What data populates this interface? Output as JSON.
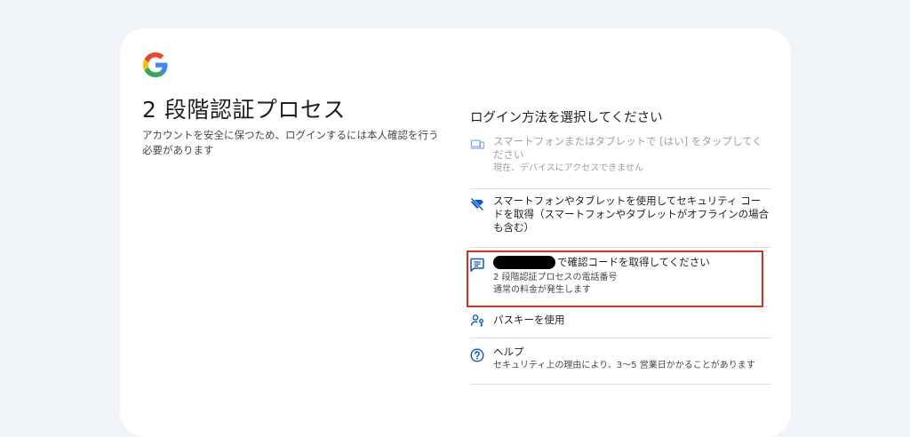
{
  "page": {
    "title": "2 段階認証プロセス",
    "description": "アカウントを安全に保つため、ログインするには本人確認を行う必要があります"
  },
  "options": {
    "heading": "ログイン方法を選択してください",
    "tap_yes": {
      "label": "スマートフォンまたはタブレットで [はい] をタップしてください",
      "detail": "現在、デバイスにアクセスできません",
      "icon": "devices-icon"
    },
    "security_code": {
      "label": "スマートフォンやタブレットを使用してセキュリティ コードを取得（スマートフォンやタブレットがオフラインの場合も含む）",
      "icon": "key-off-icon"
    },
    "sms_code": {
      "label": "で確認コードを取得してください",
      "detail1": "2 段階認証プロセスの電話番号",
      "detail2": "通常の料金が発生します",
      "icon": "sms-icon"
    },
    "passkey": {
      "label": "パスキーを使用",
      "icon": "passkey-icon"
    },
    "help": {
      "label": "ヘルプ",
      "detail": "セキュリティ上の理由により、3〜5 営業日かかることがあります",
      "icon": "help-icon"
    }
  },
  "colors": {
    "accent": "#0b57d0",
    "highlight": "#d93025",
    "background": "#f0f4f9"
  }
}
